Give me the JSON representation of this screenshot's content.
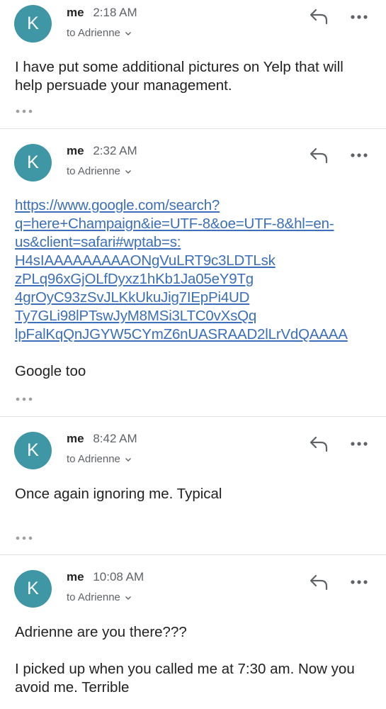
{
  "messages": [
    {
      "avatar_letter": "K",
      "sender": "me",
      "time": "2:18 AM",
      "recipient": "to Adrienne",
      "body": "I have put some additional pictures on Yelp that will help persuade your management."
    },
    {
      "avatar_letter": "K",
      "sender": "me",
      "time": "2:32 AM",
      "recipient": "to Adrienne",
      "link_lines": [
        "https://www.google.com/search?",
        "q=here+Champaign&ie=UTF-8&oe=UTF-8&hl=en-",
        "us&client=safari#wptab=s:",
        "H4sIAAAAAAAAAONgVuLRT9c3LDTLsk",
        "zPLq96xGjOLfDyxz1hKb1Ja05eY9Tg",
        "4grOyC93zSvJLKkUkuJig7IEpPi4UD",
        "Ty7GLi98lPTswJyM8MSi3LTC0vXsQq",
        "lpFalKqQnJGYW5CYmZ6nUASRAAD2lLrVdQAAAA"
      ],
      "body": "Google too"
    },
    {
      "avatar_letter": "K",
      "sender": "me",
      "time": "8:42 AM",
      "recipient": "to Adrienne",
      "body": "Once again ignoring me. Typical"
    },
    {
      "avatar_letter": "K",
      "sender": "me",
      "time": "10:08 AM",
      "recipient": "to Adrienne",
      "body_paragraphs": [
        "Adrienne are you there???",
        "I picked up when you called me at 7:30 am. Now you avoid me. Terrible"
      ]
    }
  ],
  "colors": {
    "avatar_bg": "#3f97a6",
    "link": "#3c6fb9",
    "divider": "#e3e3e3",
    "icon": "#5f6368"
  },
  "icons": {
    "reply": "reply-arrow-icon",
    "more": "more-dots-icon",
    "expand": "chevron-down-icon",
    "trimmed": "ellipsis-icon"
  }
}
